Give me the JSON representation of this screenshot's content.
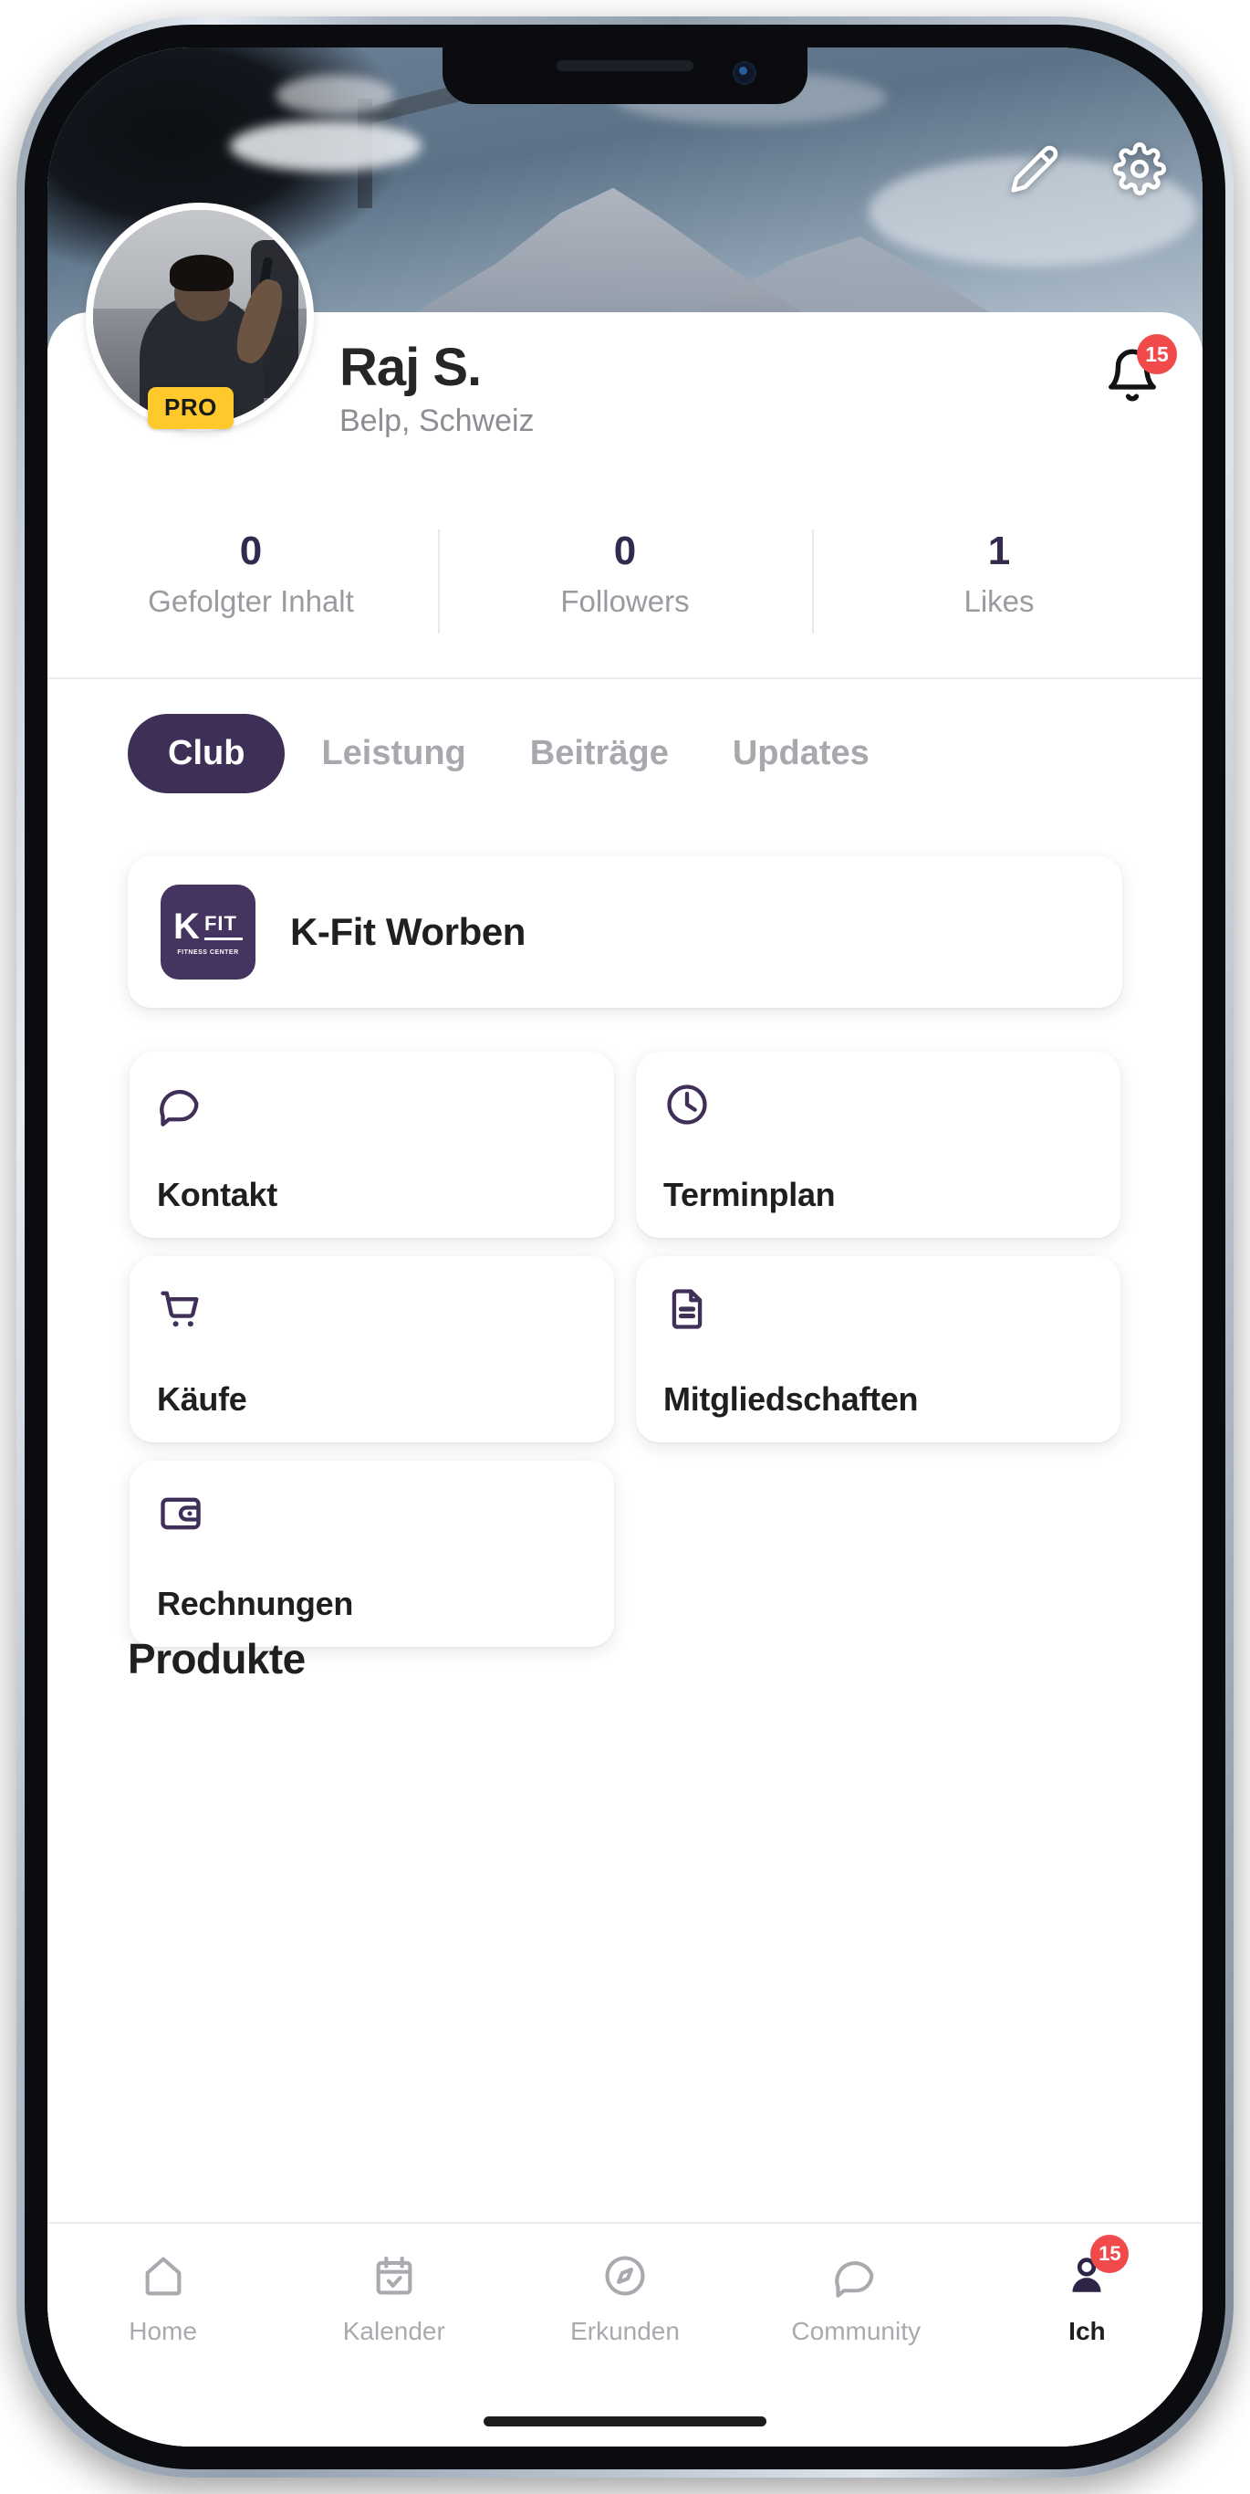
{
  "header": {
    "edit_icon": "pencil-icon",
    "settings_icon": "gear-icon"
  },
  "profile": {
    "name": "Raj S.",
    "location": "Belp, Schweiz",
    "pro_badge": "PRO",
    "avatar_alt": "profile-photo",
    "notifications": {
      "icon": "bell-icon",
      "count": "15"
    }
  },
  "stats": [
    {
      "value": "0",
      "label": "Gefolgter Inhalt"
    },
    {
      "value": "0",
      "label": "Followers"
    },
    {
      "value": "1",
      "label": "Likes"
    }
  ],
  "tabs": [
    {
      "label": "Club",
      "active": true
    },
    {
      "label": "Leistung",
      "active": false
    },
    {
      "label": "Beiträge",
      "active": false
    },
    {
      "label": "Updates",
      "active": false
    }
  ],
  "club": {
    "name": "K-Fit Worben",
    "logo_letter": "K",
    "logo_word": "FIT",
    "logo_sub": "FITNESS CENTER"
  },
  "tiles": [
    {
      "label": "Kontakt",
      "icon": "chat-bubble-icon"
    },
    {
      "label": "Terminplan",
      "icon": "clock-icon"
    },
    {
      "label": "Käufe",
      "icon": "shopping-cart-icon"
    },
    {
      "label": "Mitgliedschaften",
      "icon": "document-icon"
    },
    {
      "label": "Rechnungen",
      "icon": "wallet-icon"
    }
  ],
  "section": {
    "products_heading": "Produkte"
  },
  "bottom_nav": [
    {
      "label": "Home",
      "icon": "home-icon",
      "active": false,
      "badge": ""
    },
    {
      "label": "Kalender",
      "icon": "calendar-check-icon",
      "active": false,
      "badge": ""
    },
    {
      "label": "Erkunden",
      "icon": "compass-icon",
      "active": false,
      "badge": ""
    },
    {
      "label": "Community",
      "icon": "chat-bubble-icon",
      "active": false,
      "badge": ""
    },
    {
      "label": "Ich",
      "icon": "person-icon",
      "active": true,
      "badge": "15"
    }
  ],
  "colors": {
    "accent_purple": "#3d2f56",
    "icon_purple": "#403059",
    "badge_red": "#f04a4a",
    "pro_yellow": "#ffc92b",
    "text_dark": "#1f1f22",
    "text_muted": "#9a9aa0"
  }
}
